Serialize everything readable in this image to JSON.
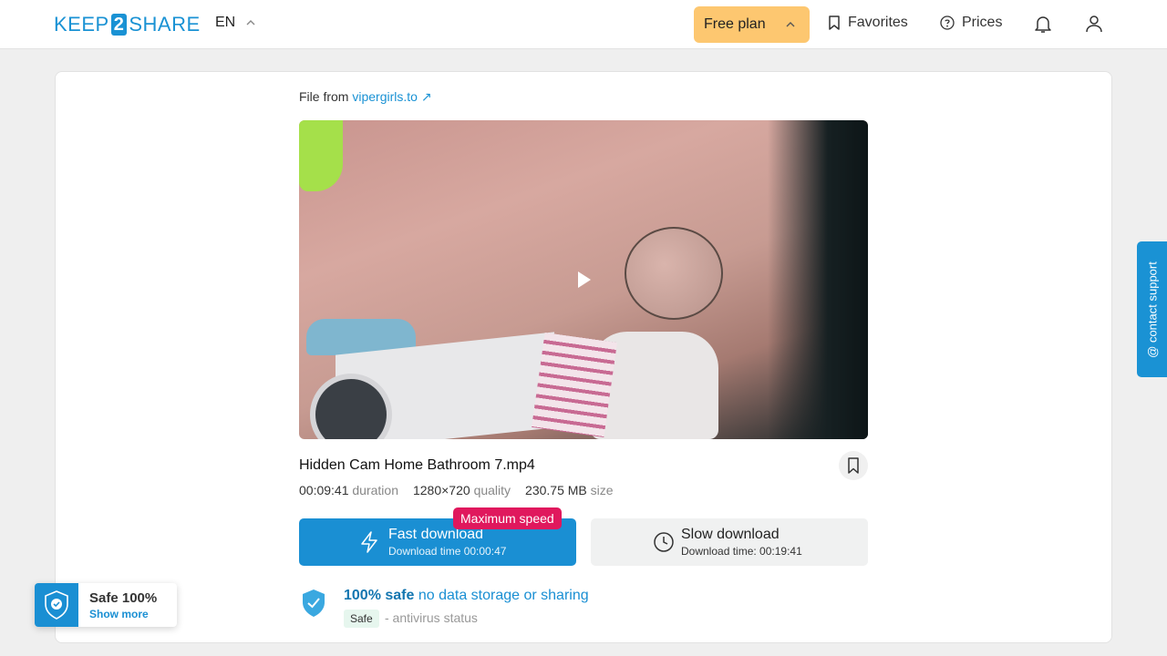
{
  "header": {
    "logo": {
      "part1": "KEEP",
      "part2": "2",
      "part3": "SHARE"
    },
    "language": "EN",
    "plan_label": "Free plan",
    "favorites_label": "Favorites",
    "prices_label": "Prices",
    "icons": {
      "chevron": "chevron-up-icon",
      "bookmark": "bookmark-icon",
      "help": "question-circle-icon",
      "bell": "bell-icon",
      "user": "user-icon"
    }
  },
  "file": {
    "from_prefix": "File from",
    "source_link": "vipergirls.to",
    "name": "Hidden Cam Home Bathroom 7.mp4",
    "duration_value": "00:09:41",
    "duration_label": "duration",
    "quality_value": "1280×720",
    "quality_label": "quality",
    "size_value": "230.75 MB",
    "size_label": "size"
  },
  "downloads": {
    "fast_label": "Fast download",
    "fast_time": "Download time 00:00:47",
    "badge": "Maximum speed",
    "slow_label": "Slow download",
    "slow_time": "Download time: 00:19:41"
  },
  "safety": {
    "title_strong": "100% safe",
    "title_rest": "no data storage or sharing",
    "tag": "Safe",
    "status": "- antivirus status"
  },
  "contact_support": "@ contact support",
  "safe_widget": {
    "title": "Safe 100%",
    "link": "Show more"
  },
  "colors": {
    "brand": "#1a92d4",
    "plan": "#fdc770",
    "badge": "#e0185d",
    "fast_button": "#1a8fd3"
  }
}
